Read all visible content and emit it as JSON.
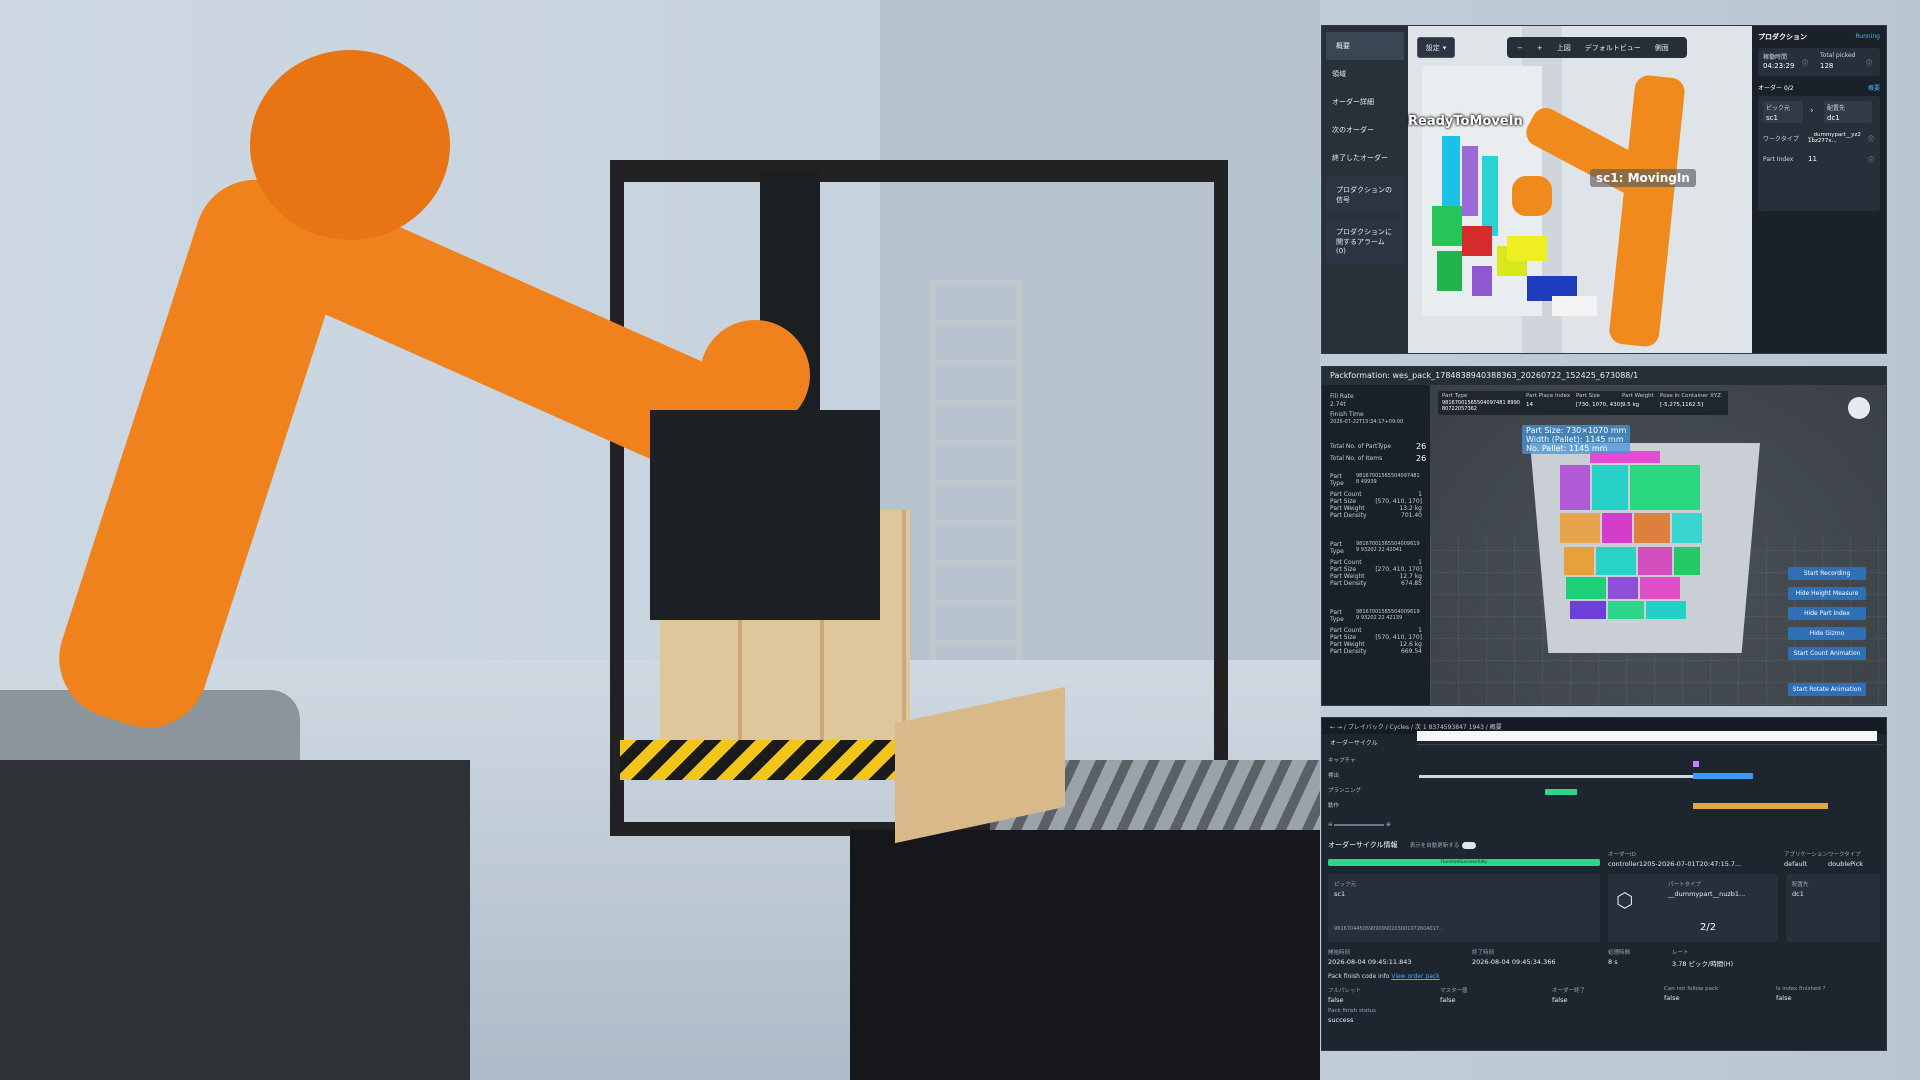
{
  "panel_viewer": {
    "menu": [
      "概要",
      "領域",
      "オーダー詳細",
      "次のオーダー",
      "終了したオーダー",
      "プロダクションの信号",
      "プロダクションに関するアラーム (0)"
    ],
    "dropdown_label": "設定",
    "toolbar": {
      "minus": "−",
      "plus": "+",
      "top": "上図",
      "default_view": "デフォルトビュー",
      "side": "側面"
    },
    "label_ready": "ReadyToMoveIn",
    "label_moving": "sc1: MovingIn",
    "side": {
      "title": "プロダクション",
      "status": "Running",
      "uptime_label": "稼働時間",
      "uptime_value": "04:23:29",
      "picked_label": "Total picked",
      "picked_value": "128",
      "orders_label": "オーダー",
      "orders_value": "0/2",
      "orders_link": "概要",
      "pick_from_label": "ピック元",
      "pick_from_value": "sc1",
      "place_to_label": "配置先",
      "place_to_value": "dc1",
      "worktype_label": "ワークタイプ",
      "worktype_value": "__dummypart__yz21bz277x...",
      "part_index_label": "Part Index",
      "part_index_value": "11"
    }
  },
  "panel_pack": {
    "title": "Packformation: wes_pack_1784838940388363_20260722_152425_673088/1",
    "left": {
      "fill_rate_label": "Fill Rate",
      "fill_rate_value": "2.74t",
      "finish_time_label": "Finish Time",
      "finish_time_value": "2026-07-22T15:34:17+09:00",
      "total_parttype_label": "Total No. of PartType",
      "total_parttype_value": "26",
      "total_items_label": "Total No. of Items",
      "total_items_value": "26",
      "parts": [
        {
          "type": "981670015655040974818 49939",
          "count": "1",
          "size": "[570, 410, 170]",
          "weight": "13.2 kg",
          "density": "701.40"
        },
        {
          "type": "981670015655040096199 93202 22 42041",
          "count": "1",
          "size": "[270, 410, 170]",
          "weight": "12.7 kg",
          "density": "674.85"
        },
        {
          "type": "981670015655040096199 93202 22 42139",
          "count": "1",
          "size": "[570, 410, 170]",
          "weight": "12.6 kg",
          "density": "669.54"
        }
      ],
      "labels": {
        "type": "Part Type",
        "count": "Part Count",
        "size": "Part Size",
        "weight": "Part Weight",
        "density": "Part Density"
      }
    },
    "info": {
      "part_type_label": "Part Type",
      "part_type_value": "98167001565504097481 899080722057362",
      "place_index_label": "Part Place Index",
      "place_index_value": "14",
      "size_label": "Part Size",
      "size_value": "[730, 1070, 430]",
      "weight_label": "Part Weight",
      "weight_value": "9.5 kg",
      "pose_label": "Pose In Container XYZ",
      "pose_value": "[-5,275,1162.5]"
    },
    "tag_lines": [
      "Part Size: 730×1070 mm",
      "Width (Pallet): 1145 mm",
      "No. Pallet: 1145 mm"
    ],
    "buttons": [
      "Start Recording",
      "Hide Height Measure",
      "Hide Part Index",
      "Hide Gizmo",
      "Start Count Animation",
      "Start Rotate Animation"
    ]
  },
  "panel_cycle": {
    "breadcrumb": "/ プレイバック / Cycles / 次 1 8374593847 1943 / 概要",
    "title": "オーダーサイクル",
    "rows": [
      "キャプチャ",
      "検出",
      "プランニング",
      "動作"
    ],
    "filter_label": "オーダーサイクル情報",
    "toggle_label": "表示を自動更新する",
    "status": "FinishedSuccessfully",
    "order_label": "オーダーID",
    "order_value": "controller1205-2026-07-01T20:47:15.7...",
    "app_label": "アプリケーション",
    "app_value": "default",
    "worktype_label": "ワークタイプ",
    "worktype_value": "doublePick",
    "pick_from_label": "ピック元",
    "pick_from_value": "sc1",
    "part_type_label": "パートタイプ",
    "part_type_value": "__dummypart__nuzb1...",
    "count": "2/2",
    "place_to_label": "配置先",
    "place_to_value": "dc1",
    "cycle_id_value": "981670445059090990203001072604017...",
    "start_label": "開始時刻",
    "start_value": "2026-08-04 09:45:11.843",
    "end_label": "終了時刻",
    "end_value": "2026-08-04 09:45:34.366",
    "duration_label": "処理時間",
    "duration_value": "8 s",
    "rate_label": "レート",
    "rate_value": "3.78 ピック/時間(H)",
    "pack_finish_label": "Pack finish code info",
    "pack_finish_link": "View order pack",
    "flags": [
      {
        "label": "フルパレット",
        "value": "false"
      },
      {
        "label": "マスター値",
        "value": "false"
      },
      {
        "label": "オーダー終了",
        "value": "false"
      },
      {
        "label": "Can not follow pack",
        "value": "false"
      },
      {
        "label": "Is index finished ?",
        "value": "false"
      }
    ],
    "pack_status_label": "Pack finish status",
    "pack_status_value": "success"
  },
  "colors": {
    "accent": "#2f6fb6",
    "success": "#2bd68a",
    "robot_orange": "#f0821d",
    "panel_bg": "#1d252e"
  }
}
